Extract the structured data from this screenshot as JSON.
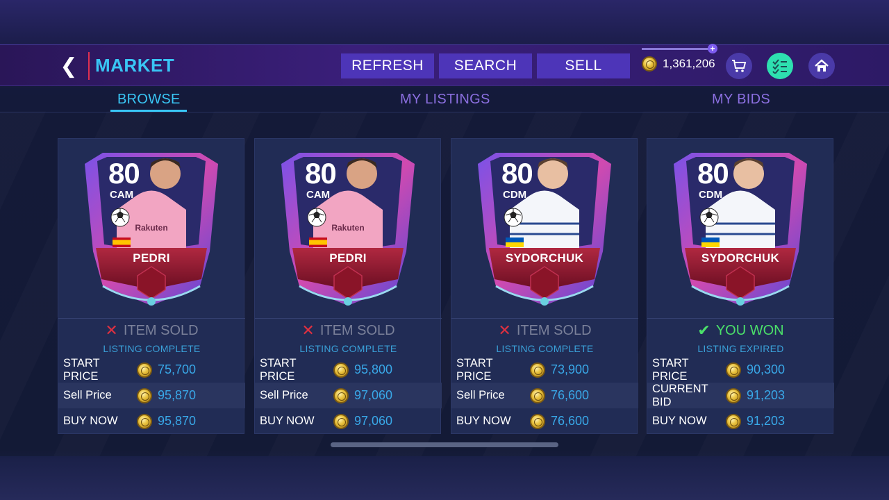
{
  "header": {
    "title": "MARKET",
    "buttons": {
      "refresh": "REFRESH",
      "search": "SEARCH",
      "sell": "SELL"
    },
    "coins": "1,361,206"
  },
  "tabs": {
    "browse": "BROWSE",
    "my_listings": "MY LISTINGS",
    "my_bids": "MY BIDS"
  },
  "cards": [
    {
      "rating": "80",
      "position": "CAM",
      "name": "PEDRI",
      "nation": "Spain",
      "status": "ITEM SOLD",
      "status_type": "sold",
      "sub_status": "LISTING COMPLETE",
      "rows": [
        {
          "label": "START PRICE",
          "value": "75,700"
        },
        {
          "label": "Sell Price",
          "value": "95,870"
        },
        {
          "label": "BUY NOW",
          "value": "95,870"
        }
      ]
    },
    {
      "rating": "80",
      "position": "CAM",
      "name": "PEDRI",
      "nation": "Spain",
      "status": "ITEM SOLD",
      "status_type": "sold",
      "sub_status": "LISTING COMPLETE",
      "rows": [
        {
          "label": "START PRICE",
          "value": "95,800"
        },
        {
          "label": "Sell Price",
          "value": "97,060"
        },
        {
          "label": "BUY NOW",
          "value": "97,060"
        }
      ]
    },
    {
      "rating": "80",
      "position": "CDM",
      "name": "SYDORCHUK",
      "nation": "Ukraine",
      "status": "ITEM SOLD",
      "status_type": "sold",
      "sub_status": "LISTING COMPLETE",
      "rows": [
        {
          "label": "START PRICE",
          "value": "73,900"
        },
        {
          "label": "Sell Price",
          "value": "76,600"
        },
        {
          "label": "BUY NOW",
          "value": "76,600"
        }
      ]
    },
    {
      "rating": "80",
      "position": "CDM",
      "name": "SYDORCHUK",
      "nation": "Ukraine",
      "status": "YOU WON",
      "status_type": "won",
      "sub_status": "LISTING EXPIRED",
      "rows": [
        {
          "label": "START PRICE",
          "value": "90,300"
        },
        {
          "label": "CURRENT BID",
          "value": "91,203"
        },
        {
          "label": "BUY NOW",
          "value": "91,203"
        }
      ]
    }
  ],
  "colors": {
    "accent": "#39c6f5",
    "button": "#4d35b8",
    "price": "#39a8e8",
    "won": "#4be06a",
    "sold_x": "#e03040"
  },
  "icons": {
    "back": "chevron-left-icon",
    "cart": "cart-icon",
    "objectives": "checklist-icon",
    "home": "home-icon",
    "coin": "coin-icon"
  }
}
